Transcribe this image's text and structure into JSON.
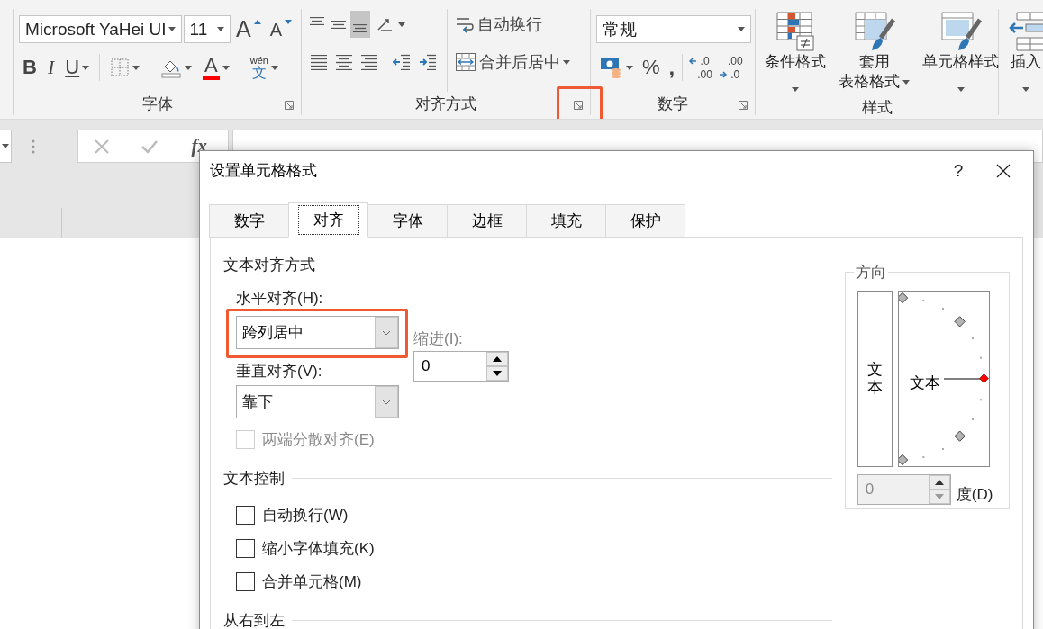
{
  "ribbon": {
    "font_group": {
      "title": "字体",
      "font_name": "Microsoft YaHei UI",
      "font_size": "11",
      "grow_font": "A",
      "shrink_font": "A",
      "bold": "B",
      "italic": "I",
      "underline": "U",
      "font_color": "A",
      "phonetic": "wén",
      "phonetic_char": "文"
    },
    "alignment_group": {
      "title": "对齐方式",
      "vertical_buttons": [
        {
          "kind": "top",
          "selected": false
        },
        {
          "kind": "middle",
          "selected": false
        },
        {
          "kind": "bottom",
          "selected": true
        }
      ],
      "wrap_text": "自动换行",
      "merge_center": "合并后居中",
      "launcher_highlighted": true
    },
    "number_group": {
      "title": "数字",
      "format": "常规",
      "percent": "%",
      "comma": ",",
      "increase_decimal": [
        ".0",
        ".00"
      ],
      "decrease_decimal": [
        ".00",
        ".0"
      ]
    },
    "styles_group": {
      "title": "样式",
      "buttons": [
        {
          "kind": "conditional",
          "lines": [
            "条件格式"
          ]
        },
        {
          "kind": "table",
          "lines": [
            "套用",
            "表格格式"
          ]
        },
        {
          "kind": "cell",
          "lines": [
            "单元格样式"
          ]
        }
      ]
    },
    "cells_group": {
      "insert": "插入"
    }
  },
  "formula_bar": {
    "function_label": "fx"
  },
  "dialog": {
    "title": "设置单元格格式",
    "help": "?",
    "tabs": [
      {
        "label": "数字",
        "selected": false
      },
      {
        "label": "对齐",
        "selected": true
      },
      {
        "label": "字体",
        "selected": false
      },
      {
        "label": "边框",
        "selected": false
      },
      {
        "label": "填充",
        "selected": false
      },
      {
        "label": "保护",
        "selected": false
      }
    ],
    "text_alignment": {
      "heading": "文本对齐方式",
      "horizontal_label": "水平对齐(H):",
      "horizontal_value": "跨列居中",
      "horizontal_highlighted": true,
      "indent_label": "缩进(I):",
      "indent_disabled": true,
      "indent_value": "0",
      "vertical_label": "垂直对齐(V):",
      "vertical_value": "靠下",
      "distributed": {
        "label": "两端分散对齐(E)",
        "checked": false,
        "disabled": true
      }
    },
    "text_control": {
      "heading": "文本控制",
      "options": [
        {
          "label": "自动换行(W)",
          "checked": false,
          "disabled": false
        },
        {
          "label": "缩小字体填充(K)",
          "checked": false,
          "disabled": false
        },
        {
          "label": "合并单元格(M)",
          "checked": false,
          "disabled": false
        }
      ]
    },
    "right_to_left": {
      "heading": "从右到左"
    },
    "orientation": {
      "heading": "方向",
      "vertical_text": "文本",
      "dial_text": "文本",
      "degrees": "0",
      "degrees_disabled": true,
      "degree_label": "度(D)"
    }
  }
}
